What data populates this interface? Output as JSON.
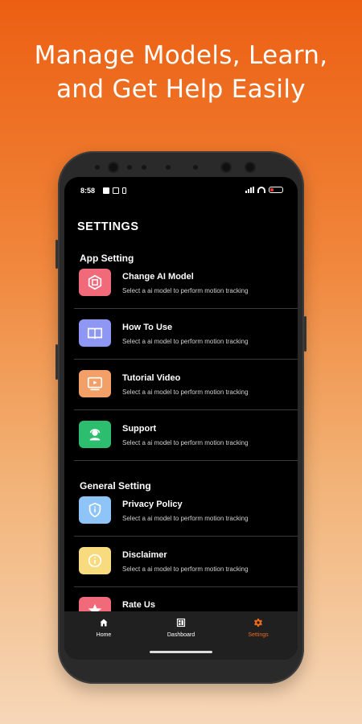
{
  "headline": {
    "line1": "Manage Models, Learn,",
    "line2": "and Get Help Easily"
  },
  "status_bar": {
    "time": "8:58",
    "icons": [
      "youtube-icon",
      "linkedin-icon",
      "battery-saver-icon"
    ],
    "right_icons": [
      "signal-icon",
      "wifi-icon",
      "battery-icon"
    ],
    "battery_color": "#E53935"
  },
  "screen": {
    "title": "SETTINGS",
    "app_section": "App Setting",
    "general_section": "General Setting"
  },
  "items": [
    {
      "name": "Change AI Model",
      "desc": "Select a ai model to perform motion tracking",
      "icon": "ai-chip-icon",
      "color": "#F06A7A"
    },
    {
      "name": "How To Use",
      "desc": "Select a ai model to perform motion tracking",
      "icon": "book-icon",
      "color": "#8E97F4"
    },
    {
      "name": "Tutorial Video",
      "desc": "Select a ai model to perform motion tracking",
      "icon": "video-icon",
      "color": "#F2A067"
    },
    {
      "name": "Support",
      "desc": "Select a ai model to perform motion tracking",
      "icon": "headset-icon",
      "color": "#2DBD6E"
    },
    {
      "name": "Privacy Policy",
      "desc": "Select a ai model to perform motion tracking",
      "icon": "shield-icon",
      "color": "#8EC4F7"
    },
    {
      "name": "Disclaimer",
      "desc": "Select a ai model to perform motion tracking",
      "icon": "info-icon",
      "color": "#F7DB7E"
    },
    {
      "name": "Rate Us",
      "desc": "",
      "icon": "star-icon",
      "color": "#F06A7A"
    }
  ],
  "nav": {
    "home": "Home",
    "dashboard": "Dashboard",
    "settings": "Settings",
    "active": "Settings",
    "active_color": "#EC6A1C"
  }
}
